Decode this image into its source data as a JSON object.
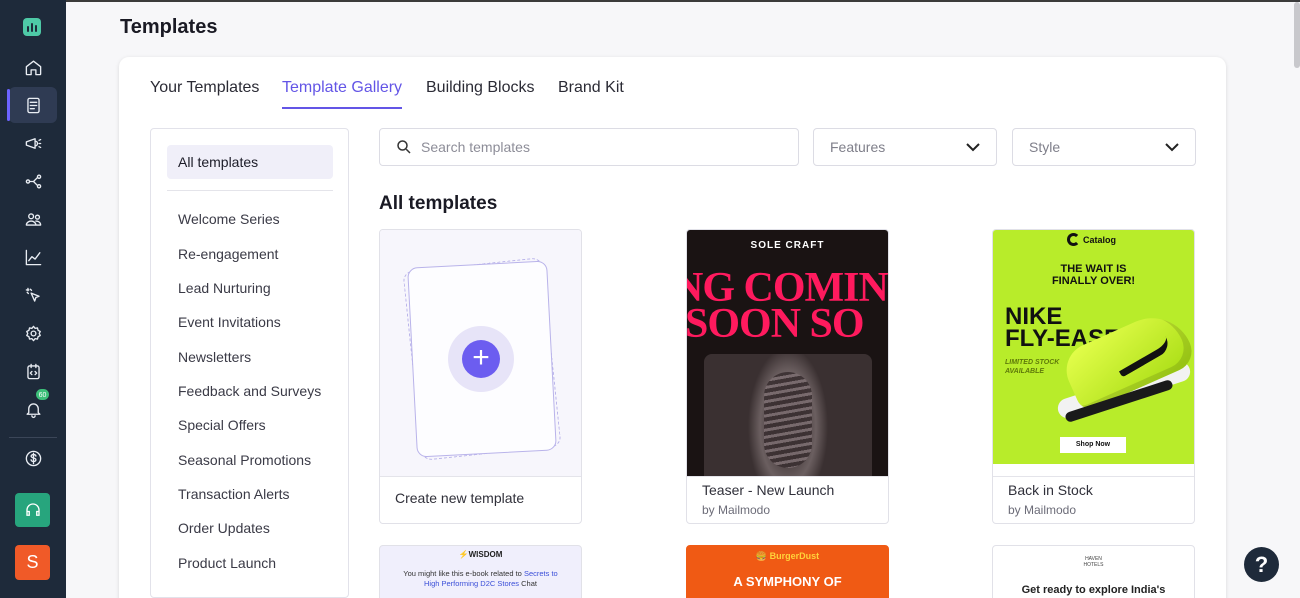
{
  "page": {
    "title": "Templates"
  },
  "tabs": [
    "Your Templates",
    "Template Gallery",
    "Building Blocks",
    "Brand Kit"
  ],
  "active_tab": "Template Gallery",
  "sidebar": {
    "all_label": "All templates",
    "items": [
      "Welcome Series",
      "Re-engagement",
      "Lead Nurturing",
      "Event Invitations",
      "Newsletters",
      "Feedback and Surveys",
      "Special Offers",
      "Seasonal Promotions",
      "Transaction Alerts",
      "Order Updates",
      "Product Launch"
    ]
  },
  "search": {
    "placeholder": "Search templates"
  },
  "filters": {
    "features": "Features",
    "style": "Style"
  },
  "section_title": "All templates",
  "create_card": {
    "label": "Create new template"
  },
  "cards": [
    {
      "name": "Teaser - New Launch",
      "by": "by Mailmodo",
      "brand": "SOLE CRAFT",
      "line1": "NG COMIN",
      "line2": "SOON SO"
    },
    {
      "name": "Back in Stock",
      "by": "by Mailmodo",
      "brand": "Catalog",
      "headline1": "THE WAIT IS",
      "headline2": "FINALLY OVER!",
      "product1": "NIKE",
      "product2": "FLY-EASE",
      "stock1": "LIMITED STOCK",
      "stock2": "AVAILABLE",
      "cta": "Shop Now"
    }
  ],
  "row2": [
    {
      "brand": "WISDOM",
      "text1": "You might like this e-book related to ",
      "link1": "Secrets to",
      "link2": "High Performing D2C Stores",
      "text2": " Chat"
    },
    {
      "brand": "BurgerDust",
      "headline": "A SYMPHONY OF"
    },
    {
      "brand1": "HAVEN",
      "brand2": "HOTELS",
      "headline": "Get ready to explore India's"
    }
  ],
  "rail": {
    "notification_count": "60",
    "avatar_initial": "S"
  },
  "help_label": "?",
  "colors": {
    "accent": "#6355e6",
    "rail": "#1e2a3a",
    "lime": "#c6ff00"
  }
}
